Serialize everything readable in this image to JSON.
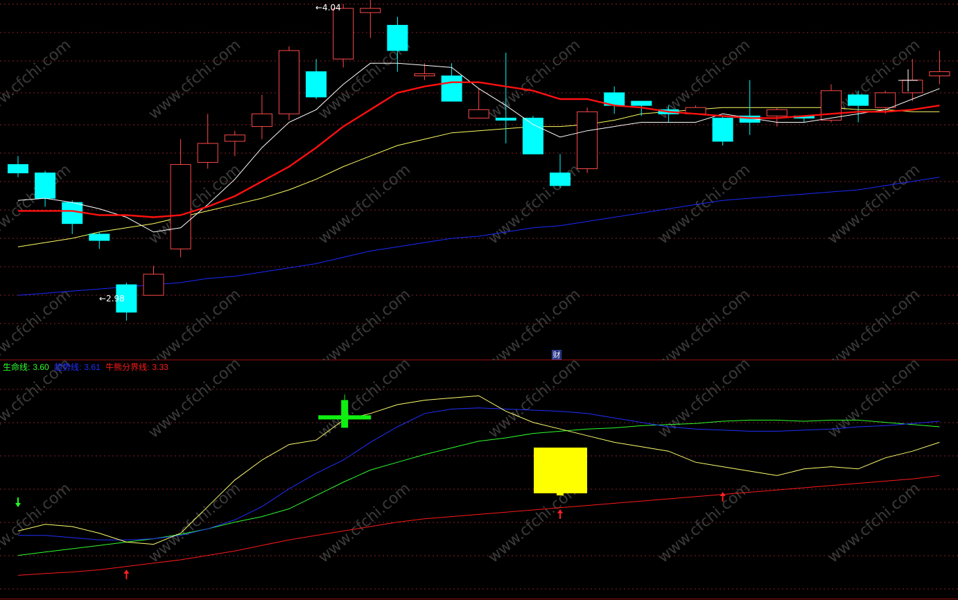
{
  "colors": {
    "background": "#000000",
    "grid": "#8a1f2a",
    "separator": "#9a1010",
    "candle_up": "#ff4a4a",
    "candle_down": "#00ffff",
    "ma5": "#ffffff",
    "ma10": "#ff1010",
    "ma20": "#ffff60",
    "ma60": "#1a2aff",
    "life_line": "#30ff30",
    "trend_line": "#2030ff",
    "boundary_line": "#ff1a1a",
    "osc_line": "#ffff70",
    "signal_cross": "#10f010",
    "signal_box": "#ffff00",
    "arrow_up": "#ff2020",
    "arrow_down": "#20ff20",
    "watermark": "#3a3a3a"
  },
  "main_chart": {
    "candles": [
      {
        "o": 3.72,
        "c": 3.68,
        "h": 3.76,
        "l": 3.66
      },
      {
        "o": 3.68,
        "c": 3.56,
        "h": 3.69,
        "l": 3.52
      },
      {
        "o": 3.54,
        "c": 3.44,
        "h": 3.55,
        "l": 3.39
      },
      {
        "o": 3.39,
        "c": 3.36,
        "h": 3.4,
        "l": 3.32
      },
      {
        "o": 3.15,
        "c": 3.02,
        "h": 3.16,
        "l": 2.98
      },
      {
        "o": 3.1,
        "c": 3.2,
        "h": 3.24,
        "l": 3.1
      },
      {
        "o": 3.32,
        "c": 3.72,
        "h": 3.84,
        "l": 3.28
      },
      {
        "o": 3.73,
        "c": 3.82,
        "h": 3.96,
        "l": 3.7
      },
      {
        "o": 3.83,
        "c": 3.86,
        "h": 3.88,
        "l": 3.76
      },
      {
        "o": 3.9,
        "c": 3.96,
        "h": 4.05,
        "l": 3.84
      },
      {
        "o": 3.96,
        "c": 4.26,
        "h": 4.28,
        "l": 3.93
      },
      {
        "o": 4.16,
        "c": 4.04,
        "h": 4.22,
        "l": 4.03
      },
      {
        "o": 4.22,
        "c": 4.46,
        "h": 4.48,
        "l": 4.18
      },
      {
        "o": 4.44,
        "c": 4.46,
        "h": 4.5,
        "l": 4.32
      },
      {
        "o": 4.38,
        "c": 4.26,
        "h": 4.42,
        "l": 4.16
      },
      {
        "o": 4.14,
        "c": 4.15,
        "h": 4.2,
        "l": 4.12
      },
      {
        "o": 4.14,
        "c": 4.02,
        "h": 4.2,
        "l": 4.03
      },
      {
        "o": 3.94,
        "c": 3.98,
        "h": 4.08,
        "l": 3.94
      },
      {
        "o": 3.94,
        "c": 3.93,
        "h": 4.25,
        "l": 3.82
      },
      {
        "o": 3.94,
        "c": 3.77,
        "h": 3.95,
        "l": 3.77
      },
      {
        "o": 3.68,
        "c": 3.62,
        "h": 3.77,
        "l": 3.61
      },
      {
        "o": 3.7,
        "c": 3.97,
        "h": 3.99,
        "l": 3.68
      },
      {
        "o": 4.06,
        "c": 4.0,
        "h": 4.09,
        "l": 3.96
      },
      {
        "o": 4.02,
        "c": 4.0,
        "h": 4.02,
        "l": 3.95
      },
      {
        "o": 3.98,
        "c": 3.96,
        "h": 4.0,
        "l": 3.92
      },
      {
        "o": 3.96,
        "c": 3.99,
        "h": 4.0,
        "l": 3.97
      },
      {
        "o": 3.94,
        "c": 3.83,
        "h": 3.95,
        "l": 3.81
      },
      {
        "o": 3.95,
        "c": 3.92,
        "h": 4.12,
        "l": 3.86
      },
      {
        "o": 3.95,
        "c": 3.98,
        "h": 3.99,
        "l": 3.9
      },
      {
        "o": 3.95,
        "c": 3.94,
        "h": 3.95,
        "l": 3.92
      },
      {
        "o": 3.93,
        "c": 4.07,
        "h": 4.1,
        "l": 3.92
      },
      {
        "o": 4.05,
        "c": 4.0,
        "h": 4.07,
        "l": 3.92
      },
      {
        "o": 3.99,
        "c": 4.06,
        "h": 4.07,
        "l": 3.96
      },
      {
        "o": 4.06,
        "c": 4.12,
        "h": 4.22,
        "l": 4.02
      },
      {
        "o": 4.14,
        "c": 4.16,
        "h": 4.26,
        "l": 4.1
      }
    ],
    "ma5": [
      3.55,
      3.56,
      3.54,
      3.51,
      3.47,
      3.4,
      3.42,
      3.53,
      3.65,
      3.8,
      3.92,
      3.98,
      4.1,
      4.2,
      4.2,
      4.19,
      4.18,
      4.08,
      4.0,
      3.91,
      3.85,
      3.88,
      3.9,
      3.92,
      3.92,
      3.92,
      3.96,
      3.94,
      3.92,
      3.92,
      3.94,
      3.96,
      3.98,
      4.03,
      4.08
    ],
    "ma10": [
      3.5,
      3.5,
      3.5,
      3.48,
      3.48,
      3.47,
      3.48,
      3.52,
      3.57,
      3.64,
      3.71,
      3.8,
      3.9,
      3.98,
      4.06,
      4.09,
      4.11,
      4.11,
      4.09,
      4.07,
      4.03,
      4.03,
      4.0,
      3.99,
      3.97,
      3.96,
      3.95,
      3.94,
      3.94,
      3.95,
      3.96,
      3.97,
      3.97,
      3.98,
      4.0
    ],
    "ma20": [
      3.33,
      3.35,
      3.37,
      3.4,
      3.42,
      3.44,
      3.47,
      3.5,
      3.53,
      3.56,
      3.6,
      3.65,
      3.71,
      3.76,
      3.81,
      3.84,
      3.87,
      3.88,
      3.89,
      3.9,
      3.9,
      3.91,
      3.93,
      3.96,
      3.97,
      3.98,
      3.99,
      3.99,
      3.99,
      3.99,
      3.99,
      3.98,
      3.98,
      3.97,
      3.97
    ],
    "ma60": [
      3.1,
      3.11,
      3.12,
      3.13,
      3.14,
      3.15,
      3.16,
      3.18,
      3.19,
      3.21,
      3.23,
      3.25,
      3.28,
      3.31,
      3.33,
      3.35,
      3.37,
      3.38,
      3.4,
      3.42,
      3.43,
      3.45,
      3.47,
      3.49,
      3.51,
      3.53,
      3.55,
      3.56,
      3.57,
      3.58,
      3.59,
      3.6,
      3.62,
      3.64,
      3.66
    ],
    "high_marker": "4.04",
    "low_marker": "2.98",
    "finance_icon": "财"
  },
  "indicator": {
    "legend": [
      {
        "label": "生命线:",
        "value": "3.60"
      },
      {
        "label": "趋势线:",
        "value": "3.61"
      },
      {
        "label": "牛熊分界线:",
        "value": "3.33"
      }
    ],
    "osc": [
      2.3,
      2.6,
      2.5,
      2.2,
      1.8,
      1.7,
      2.2,
      3.4,
      4.6,
      5.5,
      6.2,
      6.4,
      7.3,
      7.6,
      8.0,
      8.2,
      8.3,
      8.4,
      7.7,
      7.2,
      6.9,
      6.6,
      6.3,
      6.1,
      5.9,
      5.4,
      5.2,
      5.0,
      4.8,
      5.1,
      5.2,
      5.1,
      5.6,
      5.9,
      6.3
    ],
    "life_line": [
      1.2,
      1.35,
      1.5,
      1.65,
      1.8,
      1.95,
      2.15,
      2.4,
      2.7,
      2.95,
      3.3,
      3.9,
      4.5,
      5.05,
      5.4,
      5.75,
      6.05,
      6.35,
      6.5,
      6.7,
      6.8,
      6.9,
      6.95,
      7.05,
      7.1,
      7.15,
      7.25,
      7.3,
      7.3,
      7.25,
      7.3,
      7.3,
      7.2,
      7.1,
      7.0
    ],
    "trend_line": [
      2.1,
      2.1,
      2.0,
      1.9,
      1.9,
      1.95,
      2.1,
      2.4,
      2.8,
      3.4,
      4.2,
      4.9,
      5.5,
      6.3,
      7.0,
      7.6,
      7.8,
      7.85,
      7.8,
      7.75,
      7.7,
      7.6,
      7.4,
      7.2,
      7.0,
      6.9,
      6.85,
      6.8,
      6.8,
      6.85,
      6.9,
      7.0,
      7.05,
      7.15,
      7.25
    ],
    "boundary_line": [
      0.3,
      0.38,
      0.45,
      0.55,
      0.7,
      0.85,
      1.0,
      1.2,
      1.4,
      1.65,
      1.9,
      2.1,
      2.3,
      2.5,
      2.7,
      2.85,
      2.95,
      3.05,
      3.15,
      3.25,
      3.35,
      3.45,
      3.55,
      3.65,
      3.75,
      3.85,
      3.95,
      4.05,
      4.15,
      4.25,
      4.35,
      4.45,
      4.55,
      4.65,
      4.8
    ],
    "down_arrows": [
      0
    ],
    "up_arrows": [
      4,
      20,
      26
    ],
    "cross_signal_index": 12,
    "box_signal_index": 20
  },
  "watermark": "www.cfchi.com"
}
